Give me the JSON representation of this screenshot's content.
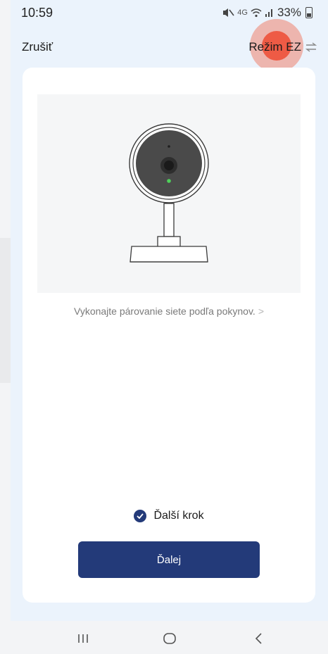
{
  "status_bar": {
    "time": "10:59",
    "network": "4G",
    "battery": "33%",
    "icons": [
      "mute-icon",
      "wifi-icon",
      "signal-icon",
      "battery-icon"
    ]
  },
  "header": {
    "cancel_label": "Zrušiť",
    "mode_label": "Režim EZ",
    "mode_icon": "swap-arrows-icon"
  },
  "main": {
    "illustration": "camera-illustration",
    "instruction_text": "Vykonajte párovanie siete podľa pokynov.",
    "instruction_chevron": ">",
    "confirm_label": "Ďalší krok",
    "confirm_checked": true,
    "next_button_label": "Ďalej"
  },
  "nav": {
    "items": [
      "recent-apps-icon",
      "home-icon",
      "back-icon"
    ]
  },
  "colors": {
    "accent": "#233a79",
    "background": "#ebf3fc",
    "card": "#ffffff",
    "touch_indicator": "#ee543c"
  }
}
